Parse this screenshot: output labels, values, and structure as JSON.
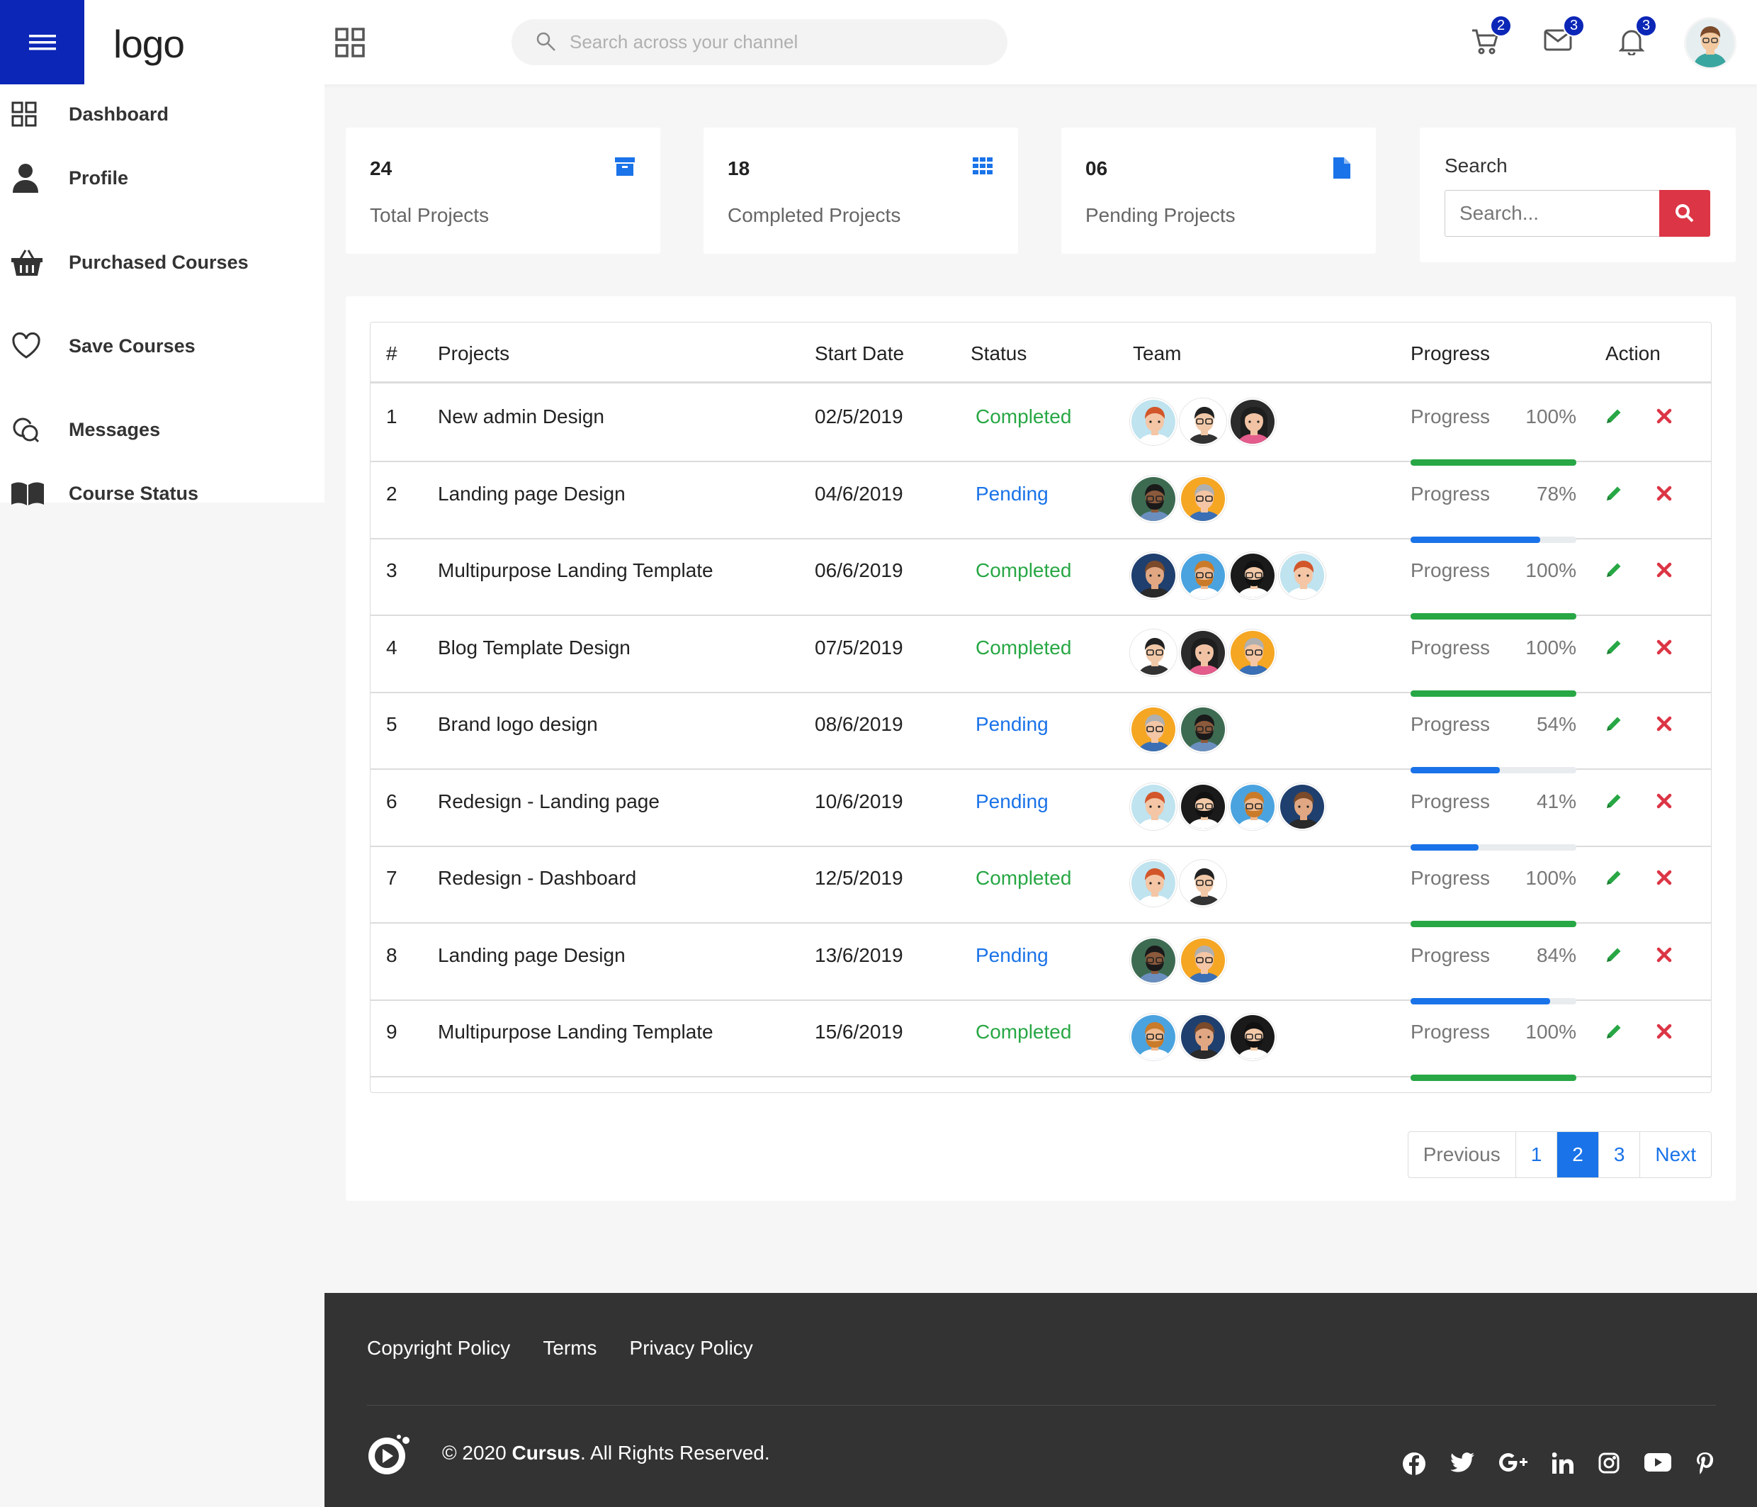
{
  "header": {
    "logo_text": "logo",
    "search_placeholder": "Search across your channel",
    "cart_count": "2",
    "mail_count": "3",
    "notif_count": "3"
  },
  "sidebar": {
    "items": [
      {
        "label": "Dashboard",
        "icon": "dashboard-icon"
      },
      {
        "label": "Profile",
        "icon": "user-icon"
      },
      {
        "label": "Purchased Courses",
        "icon": "basket-icon"
      },
      {
        "label": "Save Courses",
        "icon": "heart-icon"
      },
      {
        "label": "Messages",
        "icon": "chat-icon"
      },
      {
        "label": "Course Status",
        "icon": "book-icon"
      }
    ]
  },
  "stats": [
    {
      "value": "24",
      "label": "Total Projects",
      "icon": "archive-icon"
    },
    {
      "value": "18",
      "label": "Completed Projects",
      "icon": "grid-icon"
    },
    {
      "value": "06",
      "label": "Pending Projects",
      "icon": "file-icon"
    }
  ],
  "search_card": {
    "title": "Search",
    "placeholder": "Search..."
  },
  "table": {
    "headers": [
      "#",
      "Projects",
      "Start Date",
      "Status",
      "Team",
      "Progress",
      "Action"
    ],
    "progress_label": "Progress",
    "rows": [
      {
        "num": "1",
        "project": "New admin Design",
        "date": "02/5/2019",
        "status": "Completed",
        "team": [
          "a1",
          "a2",
          "a3"
        ],
        "progress": "100%",
        "pct": 100
      },
      {
        "num": "2",
        "project": "Landing page Design",
        "date": "04/6/2019",
        "status": "Pending",
        "team": [
          "a4",
          "a5"
        ],
        "progress": "78%",
        "pct": 78
      },
      {
        "num": "3",
        "project": "Multipurpose Landing Template",
        "date": "06/6/2019",
        "status": "Completed",
        "team": [
          "a6",
          "a7",
          "a8",
          "a1"
        ],
        "progress": "100%",
        "pct": 100
      },
      {
        "num": "4",
        "project": "Blog Template Design",
        "date": "07/5/2019",
        "status": "Completed",
        "team": [
          "a2",
          "a3",
          "a5"
        ],
        "progress": "100%",
        "pct": 100
      },
      {
        "num": "5",
        "project": "Brand logo design",
        "date": "08/6/2019",
        "status": "Pending",
        "team": [
          "a5",
          "a4"
        ],
        "progress": "54%",
        "pct": 54
      },
      {
        "num": "6",
        "project": "Redesign - Landing page",
        "date": "10/6/2019",
        "status": "Pending",
        "team": [
          "a1",
          "a8",
          "a7",
          "a6"
        ],
        "progress": "41%",
        "pct": 41
      },
      {
        "num": "7",
        "project": "Redesign - Dashboard",
        "date": "12/5/2019",
        "status": "Completed",
        "team": [
          "a1",
          "a2"
        ],
        "progress": "100%",
        "pct": 100
      },
      {
        "num": "8",
        "project": "Landing page Design",
        "date": "13/6/2019",
        "status": "Pending",
        "team": [
          "a4",
          "a5"
        ],
        "progress": "84%",
        "pct": 84
      },
      {
        "num": "9",
        "project": "Multipurpose Landing Template",
        "date": "15/6/2019",
        "status": "Completed",
        "team": [
          "a7",
          "a6",
          "a8"
        ],
        "progress": "100%",
        "pct": 100
      }
    ]
  },
  "pagination": {
    "previous": "Previous",
    "pages": [
      "1",
      "2",
      "3"
    ],
    "active": "2",
    "next": "Next"
  },
  "footer": {
    "links": [
      "Copyright Policy",
      "Terms",
      "Privacy Policy"
    ],
    "copyright_prefix": "© 2020 ",
    "brand": "Cursus",
    "copyright_suffix": ". All Rights Reserved.",
    "social": [
      "facebook-icon",
      "twitter-icon",
      "google-plus-icon",
      "linkedin-icon",
      "instagram-icon",
      "youtube-icon",
      "pinterest-icon"
    ]
  },
  "colors": {
    "brand": "#0c26b7",
    "completed": "#28a745",
    "pending": "#1a73e8",
    "danger": "#dc3545",
    "footer": "#333333"
  }
}
